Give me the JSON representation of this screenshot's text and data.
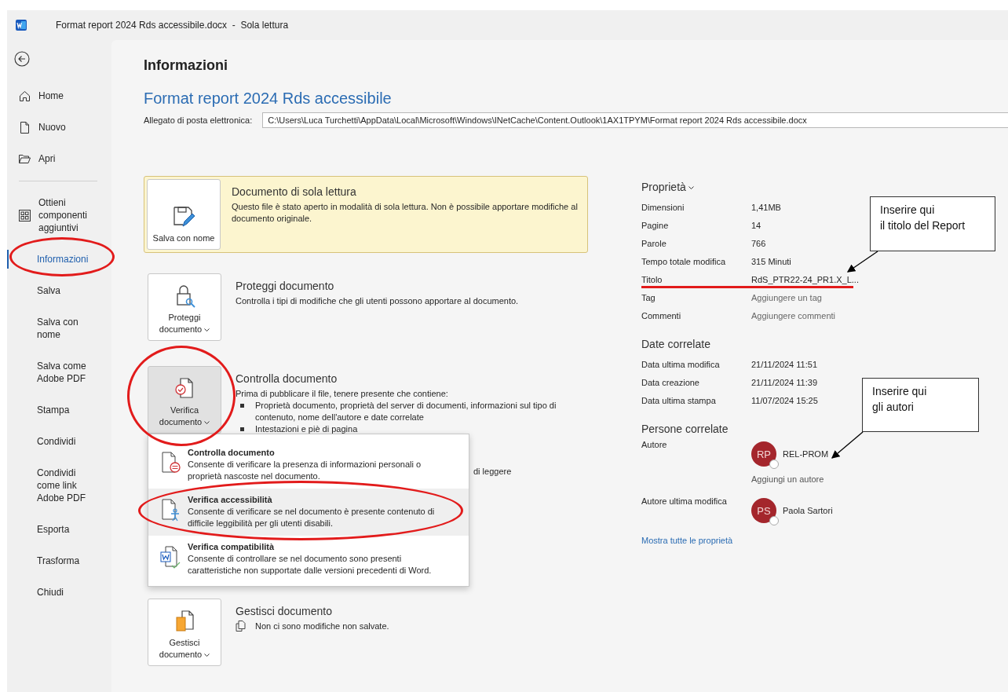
{
  "window": {
    "title": "Format report 2024 Rds accessibile.docx  -  Sola lettura"
  },
  "sidebar": {
    "items": [
      {
        "kind": "home",
        "label": "Home",
        "selected": false
      },
      {
        "kind": "new",
        "label": "Nuovo",
        "selected": false
      },
      {
        "kind": "open",
        "label": "Apri",
        "selected": false
      },
      {
        "kind": "addins",
        "label": "Ottieni componenti aggiuntivi",
        "selected": false
      },
      {
        "kind": "plain",
        "label": "Informazioni",
        "selected": true
      },
      {
        "kind": "plain",
        "label": "Salva",
        "selected": false
      },
      {
        "kind": "plain",
        "label": "Salva con nome",
        "selected": false
      },
      {
        "kind": "plain",
        "label": "Salva come Adobe PDF",
        "selected": false
      },
      {
        "kind": "plain",
        "label": "Stampa",
        "selected": false
      },
      {
        "kind": "plain",
        "label": "Condividi",
        "selected": false
      },
      {
        "kind": "plain",
        "label": "Condividi come link Adobe PDF",
        "selected": false
      },
      {
        "kind": "plain",
        "label": "Esporta",
        "selected": false
      },
      {
        "kind": "plain",
        "label": "Trasforma",
        "selected": false
      },
      {
        "kind": "plain",
        "label": "Chiudi",
        "selected": false
      }
    ]
  },
  "page": {
    "heading": "Informazioni",
    "doc_title": "Format report 2024 Rds accessibile",
    "attachment": {
      "label": "Allegato di posta elettronica:",
      "value": "C:\\Users\\Luca Turchetti\\AppData\\Local\\Microsoft\\Windows\\INetCache\\Content.Outlook\\1AX1TPYM\\Format report 2024 Rds accessibile.docx"
    }
  },
  "sections": [
    {
      "kind": "readonly",
      "button": {
        "kind": "save",
        "label": "Salva con nome",
        "dropdown": false,
        "pressed": false
      },
      "title": "Documento di sola lettura",
      "text": "Questo file è stato aperto in modalità di sola lettura. Non è possibile apportare modifiche al documento originale."
    },
    {
      "kind": "plain",
      "button": {
        "kind": "protect",
        "label": "Proteggi documento",
        "dropdown": true,
        "pressed": false
      },
      "title": "Proteggi documento",
      "text": "Controlla i tipi di modifiche che gli utenti possono apportare al documento."
    },
    {
      "kind": "inspect",
      "button": {
        "kind": "inspect",
        "label": "Verifica documento",
        "dropdown": true,
        "pressed": true
      },
      "title": "Controlla documento",
      "text": "Prima di pubblicare il file, tenere presente che contiene:",
      "bullets": [
        "Proprietà documento, proprietà del server di documenti, informazioni sul tipo di contenuto, nome dell'autore e date correlate",
        "Intestazioni e piè di pagina"
      ],
      "partial": "di leggere"
    },
    {
      "kind": "manage",
      "button": {
        "kind": "manage",
        "label": "Gestisci documento",
        "dropdown": true,
        "pressed": false
      },
      "title": "Gestisci documento",
      "note": "Non ci sono modifiche non salvate."
    }
  ],
  "menu": {
    "items": [
      {
        "kind": "inspect",
        "title": "Controlla documento",
        "text": "Consente di verificare la presenza di informazioni personali o proprietà nascoste nel documento.",
        "selected": false
      },
      {
        "kind": "accessibility",
        "title": "Verifica accessibilità",
        "text": "Consente di verificare se nel documento è presente contenuto di difficile leggibilità per gli utenti disabili.",
        "selected": true
      },
      {
        "kind": "compat",
        "title": "Verifica compatibilità",
        "text": "Consente di controllare se nel documento sono presenti caratteristiche non supportate dalle versioni precedenti di Word.",
        "selected": false
      }
    ]
  },
  "properties": {
    "heading": "Proprietà",
    "rows": [
      {
        "label": "Dimensioni",
        "value": "1,41MB",
        "kind": "value"
      },
      {
        "label": "Pagine",
        "value": "14",
        "kind": "value"
      },
      {
        "label": "Parole",
        "value": "766",
        "kind": "value"
      },
      {
        "label": "Tempo totale modifica",
        "value": "315 Minuti",
        "kind": "value"
      },
      {
        "label": "Titolo",
        "value": "RdS_PTR22-24_PR1.X_L...",
        "kind": "value"
      },
      {
        "label": "Tag",
        "value": "Aggiungere un tag",
        "kind": "prompt"
      },
      {
        "label": "Commenti",
        "value": "Aggiungere commenti",
        "kind": "prompt"
      }
    ]
  },
  "dates": {
    "heading": "Date correlate",
    "rows": [
      {
        "label": "Data ultima modifica",
        "value": "21/11/2024 11:51"
      },
      {
        "label": "Data creazione",
        "value": "21/11/2024 11:39"
      },
      {
        "label": "Data ultima stampa",
        "value": "11/07/2024 15:25"
      }
    ]
  },
  "people": {
    "heading": "Persone correlate",
    "groups": [
      {
        "label": "Autore",
        "people": [
          {
            "initials": "RP",
            "name": "REL-PROM"
          }
        ],
        "add": "Aggiungi un autore"
      },
      {
        "label": "Autore ultima modifica",
        "people": [
          {
            "initials": "PS",
            "name": "Paola Sartori"
          }
        ]
      }
    ],
    "link": "Mostra tutte le proprietà"
  },
  "callouts": [
    {
      "lines": [
        "Inserire qui",
        "il titolo del Report"
      ]
    },
    {
      "lines": [
        "Inserire qui",
        "gli autori"
      ]
    }
  ]
}
